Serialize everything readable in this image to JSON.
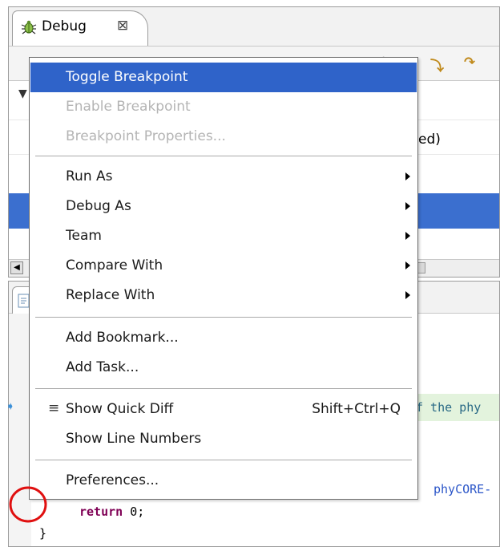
{
  "debug_view": {
    "tab_title": "Debug",
    "tree_partial_text": "ed)"
  },
  "editor": {
    "code_fragment_1": "f the phy",
    "code_fragment_2": "phyCORE-",
    "return_keyword": "return",
    "return_rest": " 0;",
    "closing_brace": "}"
  },
  "context_menu": {
    "toggle_breakpoint": "Toggle Breakpoint",
    "enable_breakpoint": "Enable Breakpoint",
    "breakpoint_properties": "Breakpoint Properties...",
    "run_as": "Run As",
    "debug_as": "Debug As",
    "team": "Team",
    "compare_with": "Compare With",
    "replace_with": "Replace With",
    "add_bookmark": "Add Bookmark...",
    "add_task": "Add Task...",
    "show_quick_diff": "Show Quick Diff",
    "show_quick_diff_shortcut": "Shift+Ctrl+Q",
    "show_line_numbers": "Show Line Numbers",
    "preferences": "Preferences..."
  },
  "colors": {
    "menu_highlight": "#2f63c9",
    "annotation": "#e01010",
    "keyword": "#7f0055"
  }
}
